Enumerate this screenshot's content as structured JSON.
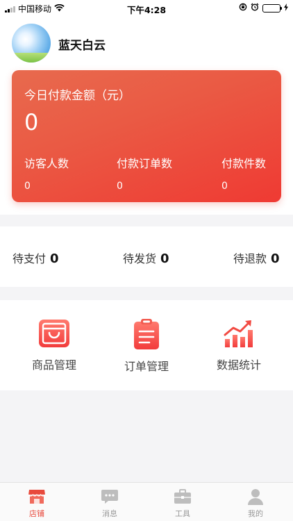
{
  "status_bar": {
    "carrier": "中国移动",
    "time": "下午4:28"
  },
  "shop": {
    "name": "蓝天白云"
  },
  "payment_card": {
    "title": "今日付款金额（元）",
    "amount": "0",
    "stats": [
      {
        "label": "访客人数",
        "value": "0"
      },
      {
        "label": "付款订单数",
        "value": "0"
      },
      {
        "label": "付款件数",
        "value": "0"
      }
    ]
  },
  "pending": [
    {
      "label": "待支付",
      "count": "0"
    },
    {
      "label": "待发货",
      "count": "0"
    },
    {
      "label": "待退款",
      "count": "0"
    }
  ],
  "menu": [
    {
      "label": "商品管理",
      "icon": "shopping-bag-icon"
    },
    {
      "label": "订单管理",
      "icon": "clipboard-icon"
    },
    {
      "label": "数据统计",
      "icon": "bar-chart-icon"
    }
  ],
  "tabbar": [
    {
      "label": "店铺",
      "icon": "store-icon",
      "active": true
    },
    {
      "label": "消息",
      "icon": "message-icon",
      "active": false
    },
    {
      "label": "工具",
      "icon": "toolbox-icon",
      "active": false
    },
    {
      "label": "我的",
      "icon": "user-icon",
      "active": false
    }
  ],
  "colors": {
    "accent": "#e84a3c",
    "card_start": "#e86a4e",
    "card_end": "#ef3a33",
    "inactive_tab": "#999999"
  }
}
